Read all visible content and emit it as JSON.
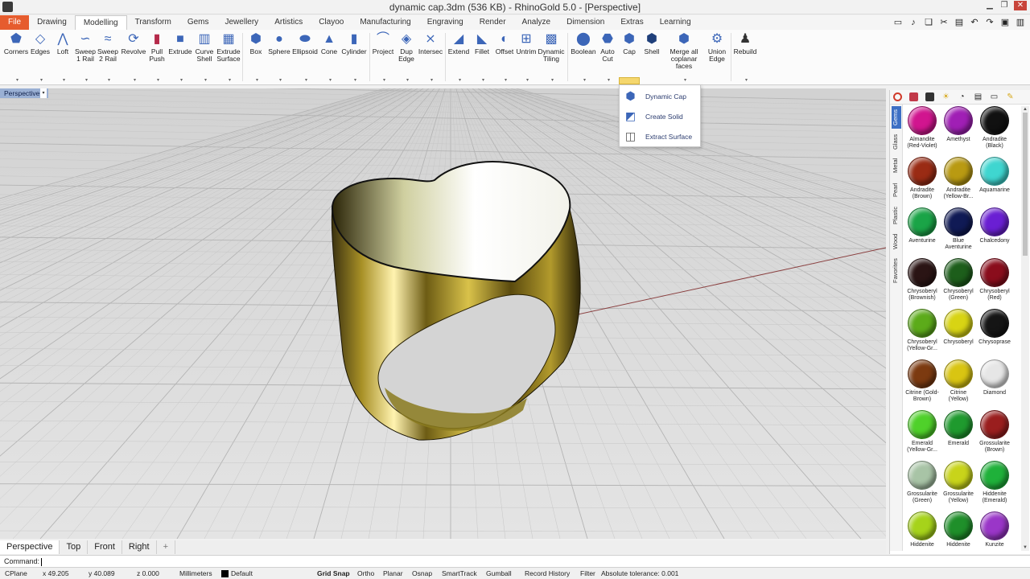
{
  "window": {
    "title": "dynamic cap.3dm (536 KB) - RhinoGold 5.0 - [Perspective]"
  },
  "menu": {
    "tabs": [
      "File",
      "Drawing",
      "Modelling",
      "Transform",
      "Gems",
      "Jewellery",
      "Artistics",
      "Clayoo",
      "Manufacturing",
      "Engraving",
      "Render",
      "Analyze",
      "Dimension",
      "Extras",
      "Learning"
    ],
    "active": "Modelling",
    "file_color": "#e65c2e"
  },
  "ribbon": {
    "buttons": [
      {
        "label": "Corners",
        "icon": "corners-icon"
      },
      {
        "label": "Edges",
        "icon": "edges-icon"
      },
      {
        "label": "Loft",
        "icon": "loft-icon"
      },
      {
        "label": "Sweep 1 Rail",
        "icon": "sweep1-icon"
      },
      {
        "label": "Sweep 2 Rail",
        "icon": "sweep2-icon"
      },
      {
        "label": "Revolve",
        "icon": "revolve-icon"
      },
      {
        "label": "Pull Push",
        "icon": "pullpush-icon"
      },
      {
        "label": "Extrude",
        "icon": "extrude-icon"
      },
      {
        "label": "Curve Shell",
        "icon": "curveshell-icon"
      },
      {
        "label": "Extrude Surface",
        "icon": "extrudesurface-icon"
      },
      {
        "label": "Box",
        "icon": "box-icon"
      },
      {
        "label": "Sphere",
        "icon": "sphere-icon"
      },
      {
        "label": "Ellipsoid",
        "icon": "ellipsoid-icon"
      },
      {
        "label": "Cone",
        "icon": "cone-icon"
      },
      {
        "label": "Cylinder",
        "icon": "cylinder-icon"
      },
      {
        "label": "Project",
        "icon": "project-icon"
      },
      {
        "label": "Dup Edge",
        "icon": "dupedge-icon"
      },
      {
        "label": "Intersec",
        "icon": "intersec-icon"
      },
      {
        "label": "Extend",
        "icon": "extend-icon"
      },
      {
        "label": "Fillet",
        "icon": "fillet-icon"
      },
      {
        "label": "Offset",
        "icon": "offset-icon"
      },
      {
        "label": "Untrim",
        "icon": "untrim-icon"
      },
      {
        "label": "Dynamic Tiling",
        "icon": "tiling-icon"
      },
      {
        "label": "Boolean",
        "icon": "boolean-icon"
      },
      {
        "label": "Auto Cut",
        "icon": "autocut-icon"
      },
      {
        "label": "Cap",
        "icon": "cap-icon"
      },
      {
        "label": "Shell",
        "icon": "shell-icon"
      },
      {
        "label": "Merge all coplanar faces",
        "icon": "merge-icon"
      },
      {
        "label": "Union Edge",
        "icon": "unionedge-icon"
      },
      {
        "label": "Rebuild",
        "icon": "rebuild-icon"
      }
    ]
  },
  "cap_menu": {
    "items": [
      {
        "label": "Dynamic Cap",
        "icon": "dynamic-cap-icon"
      },
      {
        "label": "Create Solid",
        "icon": "create-solid-icon"
      },
      {
        "label": "Extract Surface",
        "icon": "extract-surface-icon"
      }
    ]
  },
  "viewport": {
    "label": "Perspective",
    "tabs": [
      "Perspective",
      "Top",
      "Front",
      "Right"
    ],
    "active_tab": "Perspective",
    "add_tab": "+"
  },
  "command": {
    "prompt": "Command:"
  },
  "status": {
    "cplane": "CPlane",
    "x": "x 49.205",
    "y": "y 40.089",
    "z": "z 0.000",
    "units": "Millimeters",
    "layer": "Default",
    "grid_snap": "Grid Snap",
    "ortho": "Ortho",
    "planar": "Planar",
    "osnap": "Osnap",
    "smarttrack": "SmartTrack",
    "gumball": "Gumball",
    "record_history": "Record History",
    "filter": "Filter",
    "tolerance": "Absolute tolerance: 0.001"
  },
  "panel": {
    "side_tabs": [
      "Gems",
      "Glass",
      "Metal",
      "Pearl",
      "Plastic",
      "Wood",
      "Favorites"
    ],
    "active_side_tab": "Gems",
    "gems": [
      {
        "name": "Almandite (Red-Violet)",
        "color": "#d1158f"
      },
      {
        "name": "Amethyst",
        "color": "#a01fb5"
      },
      {
        "name": "Andradite (Black)",
        "color": "#111111"
      },
      {
        "name": "Andradite (Brown)",
        "color": "#9a2b14"
      },
      {
        "name": "Andradite (Yellow-Br...",
        "color": "#b99a12"
      },
      {
        "name": "Aquamarine",
        "color": "#3fd6d0"
      },
      {
        "name": "Aventurine",
        "color": "#1aa447"
      },
      {
        "name": "Blue Aventurine",
        "color": "#101a55"
      },
      {
        "name": "Chalcedony",
        "color": "#6a1fd3"
      },
      {
        "name": "Chrysoberyl (Brownish)",
        "color": "#2a1414"
      },
      {
        "name": "Chrysoberyl (Green)",
        "color": "#1d5e1b"
      },
      {
        "name": "Chrysoberyl (Red)",
        "color": "#8a0d1c"
      },
      {
        "name": "Chrysoberyl (Yellow-Gr...",
        "color": "#5cab1a"
      },
      {
        "name": "Chrysoberyl",
        "color": "#d8d414"
      },
      {
        "name": "Chrysoprase",
        "color": "#151515"
      },
      {
        "name": "Citrine (Gold-Brown)",
        "color": "#7c3a10"
      },
      {
        "name": "Citrine (Yellow)",
        "color": "#d9c512"
      },
      {
        "name": "Diamond",
        "color": "#e6e6e6"
      },
      {
        "name": "Emerald (Yellow-Gr...",
        "color": "#4fd12a"
      },
      {
        "name": "Emerald",
        "color": "#1f9a2e"
      },
      {
        "name": "Grossularite (Brown)",
        "color": "#9a1e1e"
      },
      {
        "name": "Grossularite (Green)",
        "color": "#a8c4a6"
      },
      {
        "name": "Grossularite (Yellow)",
        "color": "#c8d41a"
      },
      {
        "name": "Hiddenite (Emerald)",
        "color": "#1fb13a"
      },
      {
        "name": "Hiddenite",
        "color": "#a6d31a"
      },
      {
        "name": "Hiddenite",
        "color": "#1f8f2a"
      },
      {
        "name": "Kunzite",
        "color": "#9a36c8"
      }
    ]
  }
}
